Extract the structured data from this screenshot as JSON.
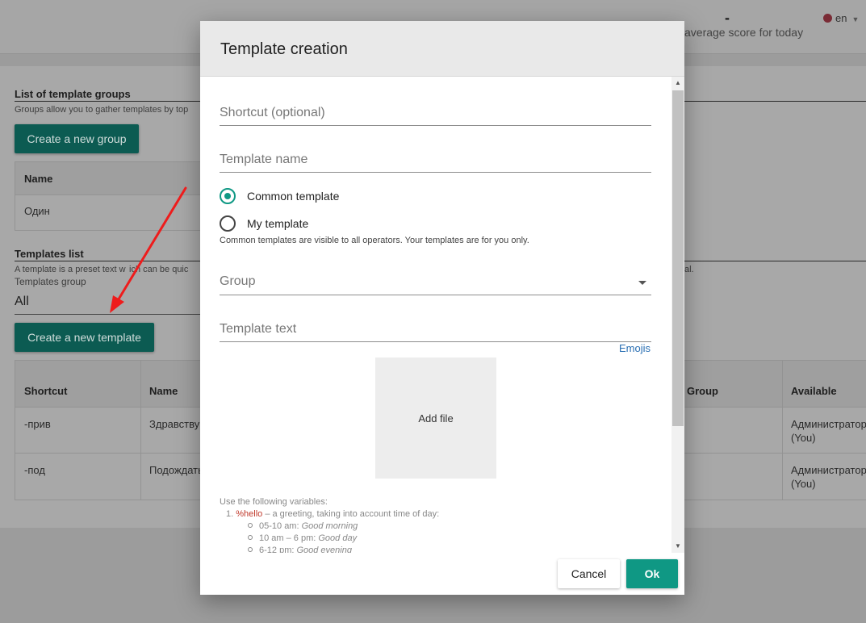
{
  "topbar": {
    "dash": "-",
    "avg_score": "average score for today",
    "language": "en"
  },
  "groups_section": {
    "title": "List of template groups",
    "subtitle": "Groups allow you to gather templates by top",
    "create_button": "Create a new group",
    "table": {
      "header": "Name",
      "rows": [
        "Один"
      ]
    }
  },
  "templates_section": {
    "title": "Templates list",
    "subtitle_left": "A template is a preset text w",
    "subtitle_mid": "ich can be quic",
    "subtitle_right": "al.",
    "group_label": "Templates group",
    "group_value": "All",
    "create_button": "Create a new template",
    "table": {
      "headers": [
        "Shortcut",
        "Name",
        "Group",
        "Available"
      ],
      "rows": [
        {
          "shortcut": "-прив",
          "name": "Здравству",
          "available_1": "Администратор",
          "available_2": "(You)"
        },
        {
          "shortcut": "-под",
          "name": "Подождать",
          "available_1": "Администратор",
          "available_2": "(You)"
        }
      ]
    }
  },
  "modal": {
    "title": "Template creation",
    "shortcut_placeholder": "Shortcut (optional)",
    "name_placeholder": "Template name",
    "radio_common": "Common template",
    "radio_my": "My template",
    "radio_selected": "Common template",
    "radio_help": "Common templates are visible to all operators. Your templates are for you only.",
    "group_placeholder": "Group",
    "text_placeholder": "Template text",
    "emojis_link": "Emojis",
    "add_file": "Add file",
    "variables_intro": "Use the following variables:",
    "var_number": "1.",
    "var_name": "%hello",
    "var_desc": " – a greeting, taking into account time of day:",
    "times": [
      {
        "range": "05-10 am: ",
        "greeting": "Good morning"
      },
      {
        "range": "10 am – 6 pm: ",
        "greeting": "Good day"
      },
      {
        "range": "6-12 pm: ",
        "greeting": "Good evening"
      }
    ],
    "cancel_button": "Cancel",
    "ok_button": "Ok"
  },
  "colors": {
    "accent": "#0f9884",
    "link": "#2a6fb3",
    "annotation_arrow": "#ee1c1c"
  }
}
